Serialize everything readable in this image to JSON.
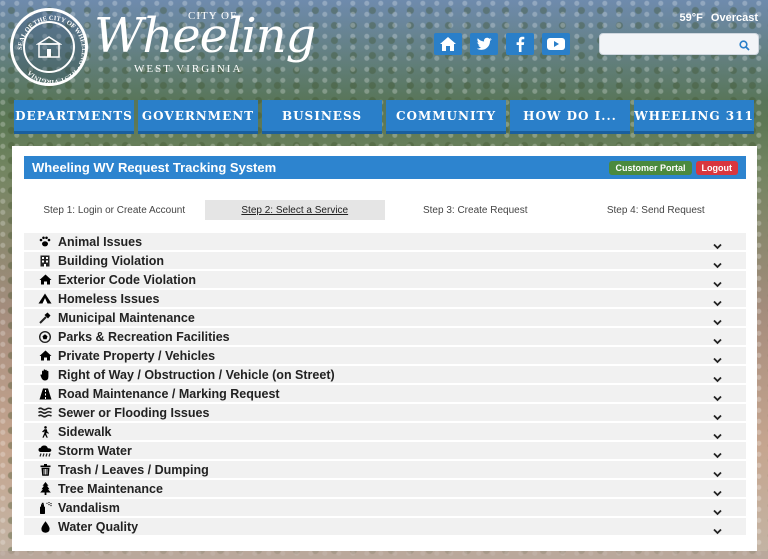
{
  "header": {
    "logo_cityof": "CITY OF",
    "logo_name": "Wheeling",
    "logo_state": "WEST VIRGINIA",
    "seal_text": "SEAL OF THE CITY OF WHEELING • WEST VIRGINIA",
    "weather_temp": "59°F",
    "weather_cond": "Overcast",
    "social_icons": [
      "home-icon",
      "twitter-icon",
      "facebook-icon",
      "youtube-icon"
    ],
    "search_placeholder": ""
  },
  "nav": {
    "tabs": [
      "DEPARTMENTS",
      "GOVERNMENT",
      "BUSINESS",
      "COMMUNITY",
      "HOW DO I...",
      "WHEELING 311"
    ]
  },
  "panel": {
    "title": "Wheeling WV Request Tracking System",
    "customer_portal": "Customer Portal",
    "logout": "Logout",
    "steps": [
      "Step 1: Login or Create Account",
      "Step 2: Select a Service",
      "Step 3: Create Request",
      "Step 4: Send Request"
    ],
    "active_step": 1
  },
  "services": [
    {
      "label": "Animal Issues",
      "icon": "paw-icon"
    },
    {
      "label": "Building Violation",
      "icon": "building-icon"
    },
    {
      "label": "Exterior Code Violation",
      "icon": "house-icon"
    },
    {
      "label": "Homeless Issues",
      "icon": "tent-icon"
    },
    {
      "label": "Municipal Maintenance",
      "icon": "hammer-icon"
    },
    {
      "label": "Parks & Recreation Facilities",
      "icon": "soccer-ball-icon"
    },
    {
      "label": "Private Property / Vehicles",
      "icon": "house-icon"
    },
    {
      "label": "Right of Way / Obstruction / Vehicle (on Street)",
      "icon": "hand-icon"
    },
    {
      "label": "Road Maintenance / Marking Request",
      "icon": "road-icon"
    },
    {
      "label": "Sewer or Flooding Issues",
      "icon": "water-waves-icon"
    },
    {
      "label": "Sidewalk",
      "icon": "walking-icon"
    },
    {
      "label": "Storm Water",
      "icon": "cloud-rain-icon"
    },
    {
      "label": "Trash / Leaves / Dumping",
      "icon": "trash-icon"
    },
    {
      "label": "Tree Maintenance",
      "icon": "tree-icon"
    },
    {
      "label": "Vandalism",
      "icon": "spray-can-icon"
    },
    {
      "label": "Water Quality",
      "icon": "droplet-icon"
    }
  ],
  "colors": {
    "nav_blue": "#2a7fc9",
    "title_blue": "#2d84cf",
    "portal_green": "#4b8a3e",
    "logout_red": "#d9363e"
  }
}
